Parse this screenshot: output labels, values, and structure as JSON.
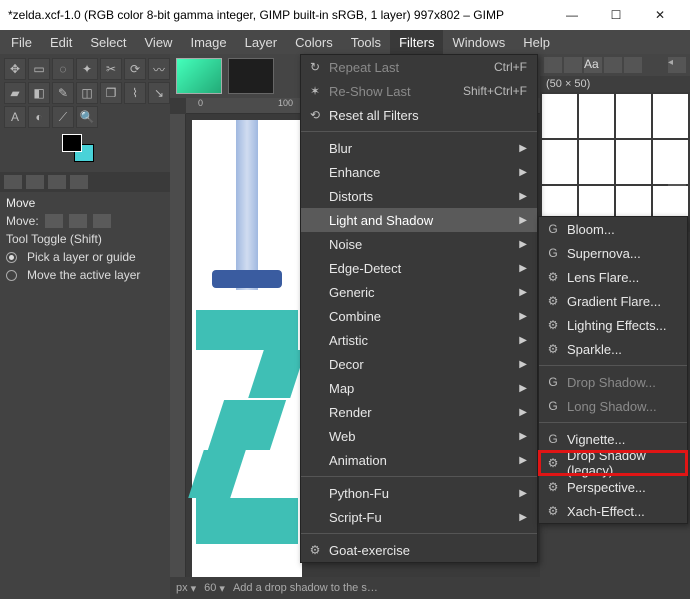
{
  "window": {
    "title": "*zelda.xcf-1.0 (RGB color 8-bit gamma integer, GIMP built-in sRGB, 1 layer) 997x802 – GIMP"
  },
  "menubar": [
    "File",
    "Edit",
    "Select",
    "View",
    "Image",
    "Layer",
    "Colors",
    "Tools",
    "Filters",
    "Windows",
    "Help"
  ],
  "active_menu": "Filters",
  "filters_menu": {
    "top": [
      {
        "label": "Repeat Last",
        "shortcut": "Ctrl+F",
        "dim": true,
        "icon": "↻"
      },
      {
        "label": "Re-Show Last",
        "shortcut": "Shift+Ctrl+F",
        "dim": true,
        "icon": "✶"
      },
      {
        "label": "Reset all Filters",
        "icon": "⟲"
      }
    ],
    "groups": [
      "Blur",
      "Enhance",
      "Distorts",
      "Light and Shadow",
      "Noise",
      "Edge-Detect",
      "Generic",
      "Combine",
      "Artistic",
      "Decor",
      "Map",
      "Render",
      "Web",
      "Animation"
    ],
    "hover": "Light and Shadow",
    "bottom": [
      "Python-Fu",
      "Script-Fu"
    ],
    "extras": [
      {
        "label": "Goat-exercise",
        "icon": "⚙"
      }
    ]
  },
  "light_shadow_submenu": {
    "groups": [
      [
        "Bloom...",
        "Supernova...",
        "Lens Flare...",
        "Gradient Flare...",
        "Lighting Effects...",
        "Sparkle..."
      ],
      [
        "Drop Shadow...",
        "Long Shadow..."
      ],
      [
        "Vignette...",
        "Drop Shadow (legacy)...",
        "Perspective...",
        "Xach-Effect..."
      ]
    ],
    "dim": [
      "Drop Shadow...",
      "Long Shadow..."
    ],
    "highlight": "Drop Shadow (legacy)..."
  },
  "left_panel": {
    "tool_title": "Move",
    "move_label": "Move:",
    "toggle_label": "Tool Toggle  (Shift)",
    "opt1": "Pick a layer or guide",
    "opt2": "Move the active layer"
  },
  "right_panel": {
    "brush_info": "(50 × 50)"
  },
  "ruler_ticks": [
    "0",
    "100"
  ],
  "statusbar": {
    "unit": "px",
    "zoom": "60",
    "msg": "Add a drop shadow to the s…"
  }
}
